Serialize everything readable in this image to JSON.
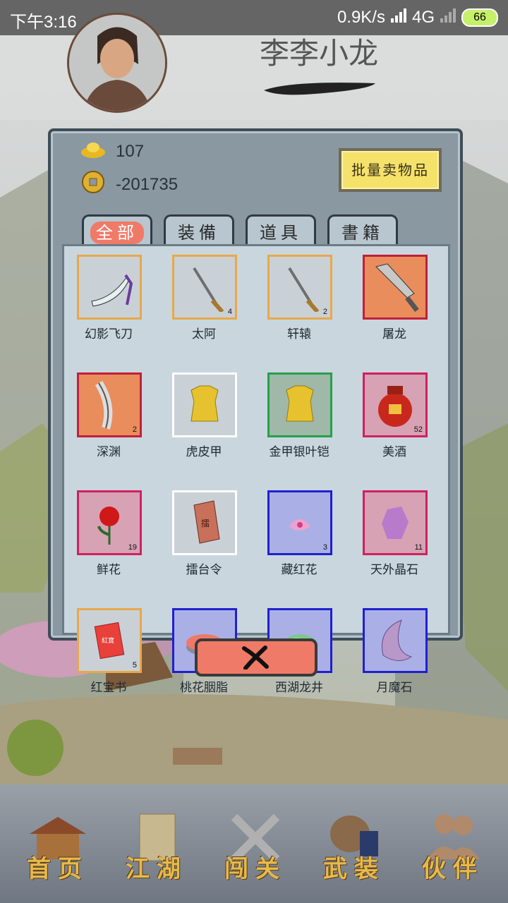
{
  "status_bar": {
    "time": "下午3:16",
    "network_speed": "0.9K/s",
    "network_type": "4G",
    "battery": "66"
  },
  "player": {
    "name": "李李小龙"
  },
  "currency": {
    "gold": "107",
    "coins": "-201735"
  },
  "sell_button_label": "批量卖物品",
  "tabs": [
    {
      "label": "全部",
      "active": true
    },
    {
      "label": "装備",
      "active": false
    },
    {
      "label": "道具",
      "active": false
    },
    {
      "label": "書籍",
      "active": false
    }
  ],
  "items": [
    {
      "name": "幻影飞刀",
      "count": "",
      "rarity_color": "#e8a84a",
      "bg": "#c9d1d6",
      "icon": "flying-knife-icon"
    },
    {
      "name": "太阿",
      "count": "4",
      "rarity_color": "#e8a84a",
      "bg": "#c9d1d6",
      "icon": "sword-icon"
    },
    {
      "name": "轩辕",
      "count": "2",
      "rarity_color": "#e8a84a",
      "bg": "#c9d1d6",
      "icon": "sword-icon"
    },
    {
      "name": "屠龙",
      "count": "",
      "rarity_color": "#c0203a",
      "bg": "#e98d5d",
      "icon": "broadsword-icon"
    },
    {
      "name": "深渊",
      "count": "2",
      "rarity_color": "#c0203a",
      "bg": "#e98d5d",
      "icon": "saber-icon"
    },
    {
      "name": "虎皮甲",
      "count": "",
      "rarity_color": "#ffffff",
      "bg": "#c9d1d6",
      "icon": "armor-icon"
    },
    {
      "name": "金甲银叶铠",
      "count": "",
      "rarity_color": "#26a04a",
      "bg": "#9fb8a8",
      "icon": "armor-icon"
    },
    {
      "name": "美酒",
      "count": "52",
      "rarity_color": "#d02060",
      "bg": "#d6a2b4",
      "icon": "wine-jar-icon"
    },
    {
      "name": "鲜花",
      "count": "19",
      "rarity_color": "#d02060",
      "bg": "#d6a2b4",
      "icon": "flower-icon"
    },
    {
      "name": "擂台令",
      "count": "",
      "rarity_color": "#ffffff",
      "bg": "#c9d1d6",
      "icon": "token-icon"
    },
    {
      "name": "藏红花",
      "count": "3",
      "rarity_color": "#2020d0",
      "bg": "#aab0e6",
      "icon": "saffron-icon"
    },
    {
      "name": "天外晶石",
      "count": "11",
      "rarity_color": "#d02060",
      "bg": "#d6a2b4",
      "icon": "crystal-icon"
    },
    {
      "name": "红宝书",
      "count": "5",
      "rarity_color": "#e8a84a",
      "bg": "#c9d1d6",
      "icon": "red-book-icon"
    },
    {
      "name": "桃花胭脂",
      "count": "",
      "rarity_color": "#2020d0",
      "bg": "#aab0e6",
      "icon": "rouge-icon"
    },
    {
      "name": "西湖龙井",
      "count": "",
      "rarity_color": "#2020d0",
      "bg": "#aab0e6",
      "icon": "tea-icon"
    },
    {
      "name": "月魔石",
      "count": "",
      "rarity_color": "#2020d0",
      "bg": "#aab0e6",
      "icon": "moon-stone-icon"
    }
  ],
  "bottom_nav": [
    {
      "label": "首页",
      "icon": "house-icon"
    },
    {
      "label": "江湖",
      "icon": "scroll-icon"
    },
    {
      "label": "闯关",
      "icon": "crossed-swords-icon"
    },
    {
      "label": "武装",
      "icon": "armor-book-icon"
    },
    {
      "label": "伙伴",
      "icon": "people-icon"
    }
  ]
}
